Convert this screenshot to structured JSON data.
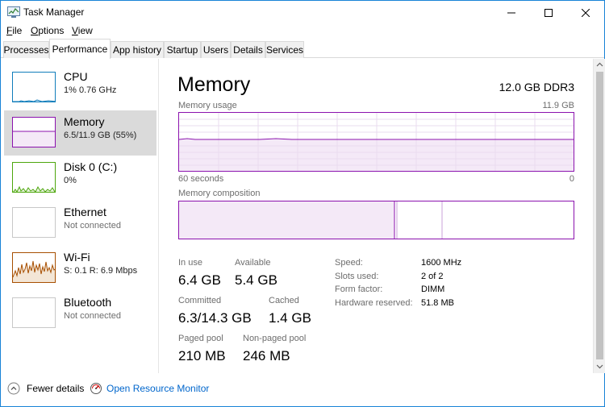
{
  "window": {
    "title": "Task Manager"
  },
  "menu": [
    {
      "label": "File",
      "u": "F",
      "rest": "ile"
    },
    {
      "label": "Options",
      "u": "O",
      "rest": "ptions"
    },
    {
      "label": "View",
      "u": "V",
      "rest": "iew"
    }
  ],
  "tabs": [
    "Processes",
    "Performance",
    "App history",
    "Startup",
    "Users",
    "Details",
    "Services"
  ],
  "active_tab": "Performance",
  "resources": [
    {
      "name": "CPU",
      "sub": "1%  0.76 GHz",
      "icon": "cpu-graph",
      "color": "#117dbb"
    },
    {
      "name": "Memory",
      "sub": "6.5/11.9 GB (55%)",
      "icon": "memory-graph",
      "color": "#8b12ae"
    },
    {
      "name": "Disk 0 (C:)",
      "sub": "0%",
      "icon": "disk-graph",
      "color": "#4da60c"
    },
    {
      "name": "Ethernet",
      "sub": "Not connected",
      "icon": "ethernet-graph",
      "color": "#a5a5a5"
    },
    {
      "name": "Wi-Fi",
      "sub": "S: 0.1  R: 6.9 Mbps",
      "icon": "wifi-graph",
      "color": "#a74f01"
    },
    {
      "name": "Bluetooth",
      "sub": "Not connected",
      "icon": "bluetooth-graph",
      "color": "#a5a5a5"
    }
  ],
  "main": {
    "title": "Memory",
    "spec": "12.0 GB DDR3",
    "usage_label": "Memory usage",
    "usage_max": "11.9 GB",
    "axis_left": "60 seconds",
    "axis_right": "0",
    "composition_label": "Memory composition",
    "accent": "#8b12ae"
  },
  "stats": {
    "in_use_label": "In use",
    "in_use": "6.4 GB",
    "available_label": "Available",
    "available": "5.4 GB",
    "committed_label": "Committed",
    "committed": "6.3/14.3 GB",
    "cached_label": "Cached",
    "cached": "1.4 GB",
    "paged_label": "Paged pool",
    "paged": "210 MB",
    "nonpaged_label": "Non-paged pool",
    "nonpaged": "246 MB"
  },
  "details": [
    {
      "key": "Speed:",
      "value": "1600 MHz"
    },
    {
      "key": "Slots used:",
      "value": "2 of 2"
    },
    {
      "key": "Form factor:",
      "value": "DIMM"
    },
    {
      "key": "Hardware reserved:",
      "value": "51.8 MB"
    }
  ],
  "footer": {
    "fewer_details": "Fewer details",
    "fewer_details_u": "d",
    "open_monitor": "Open Resource Monitor"
  }
}
